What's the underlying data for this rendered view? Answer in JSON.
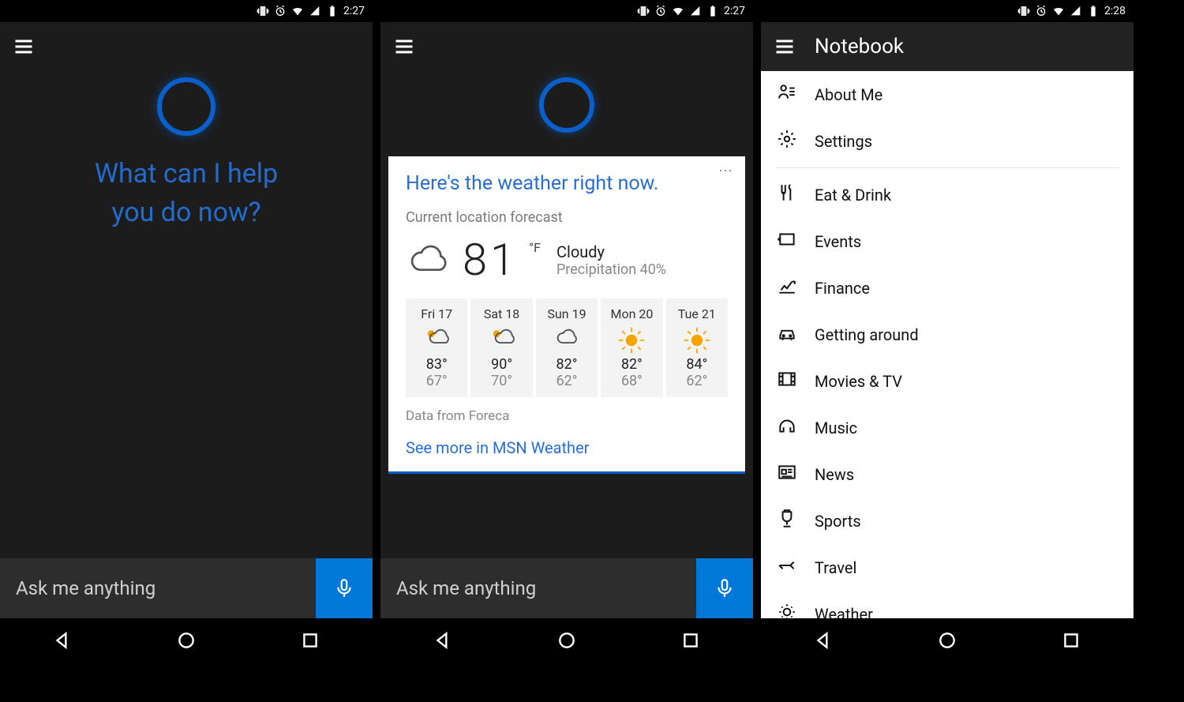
{
  "screens": {
    "left": {
      "time": "2:27",
      "prompt": "What can I help\nyou do now?",
      "ask": "Ask me anything"
    },
    "mid": {
      "time": "2:27",
      "ask": "Ask me anything",
      "card": {
        "title": "Here's the weather right now.",
        "subtitle": "Current location forecast",
        "temp": "81",
        "unit": "°F",
        "condition": "Cloudy",
        "precip": "Precipitation 40%",
        "forecast": [
          {
            "label": "Fri 17",
            "icon": "partly",
            "hi": "83°",
            "lo": "67°"
          },
          {
            "label": "Sat 18",
            "icon": "partly",
            "hi": "90°",
            "lo": "70°"
          },
          {
            "label": "Sun 19",
            "icon": "cloudy",
            "hi": "82°",
            "lo": "62°"
          },
          {
            "label": "Mon 20",
            "icon": "sunny",
            "hi": "82°",
            "lo": "68°"
          },
          {
            "label": "Tue 21",
            "icon": "sunny",
            "hi": "84°",
            "lo": "62°"
          }
        ],
        "source": "Data from Foreca",
        "link": "See more in MSN Weather"
      }
    },
    "right": {
      "time": "2:28",
      "title": "Notebook",
      "top_items": [
        {
          "icon": "about",
          "label": "About Me"
        },
        {
          "icon": "settings",
          "label": "Settings"
        }
      ],
      "items": [
        {
          "icon": "eat",
          "label": "Eat & Drink"
        },
        {
          "icon": "events",
          "label": "Events"
        },
        {
          "icon": "finance",
          "label": "Finance"
        },
        {
          "icon": "car",
          "label": "Getting around"
        },
        {
          "icon": "movies",
          "label": "Movies & TV"
        },
        {
          "icon": "music",
          "label": "Music"
        },
        {
          "icon": "news",
          "label": "News"
        },
        {
          "icon": "sports",
          "label": "Sports"
        },
        {
          "icon": "travel",
          "label": "Travel"
        },
        {
          "icon": "weather",
          "label": "Weather"
        }
      ]
    }
  }
}
